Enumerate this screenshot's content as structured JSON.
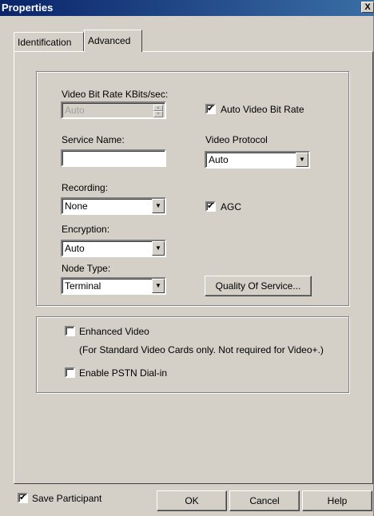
{
  "window": {
    "title": "Properties",
    "close_glyph": "X"
  },
  "tabs": [
    {
      "label": "Identification",
      "active": false
    },
    {
      "label": "Advanced",
      "active": true
    }
  ],
  "advanced": {
    "video_bit_rate": {
      "label": "Video Bit Rate KBits/sec:",
      "value": "Auto",
      "disabled": true
    },
    "auto_video_bit_rate": {
      "label": "Auto Video Bit Rate",
      "checked": true
    },
    "service_name": {
      "label": "Service Name:",
      "value": ""
    },
    "video_protocol": {
      "label": "Video Protocol",
      "value": "Auto"
    },
    "recording": {
      "label": "Recording:",
      "value": "None"
    },
    "agc": {
      "label": "AGC",
      "checked": true
    },
    "encryption": {
      "label": "Encryption:",
      "value": "Auto"
    },
    "node_type": {
      "label": "Node Type:",
      "value": "Terminal"
    },
    "quality_of_service_button": "Quality Of Service...",
    "enhanced_video": {
      "label": "Enhanced Video",
      "checked": false
    },
    "enhanced_video_note": "(For Standard Video Cards only. Not required for Video+.)",
    "enable_pstn": {
      "label": "Enable PSTN Dial-in",
      "checked": false
    }
  },
  "footer": {
    "save_participant": {
      "label": "Save Participant",
      "checked": true
    },
    "ok_label": "OK",
    "cancel_label": "Cancel",
    "help_label": "Help"
  },
  "colors": {
    "face": "#d4d0c8",
    "title_start": "#0a246a",
    "title_end": "#3a6ea5"
  },
  "icons": {
    "checkmark": "✔",
    "dropdown": "▼",
    "spin_up": "▲",
    "spin_down": "▼"
  }
}
